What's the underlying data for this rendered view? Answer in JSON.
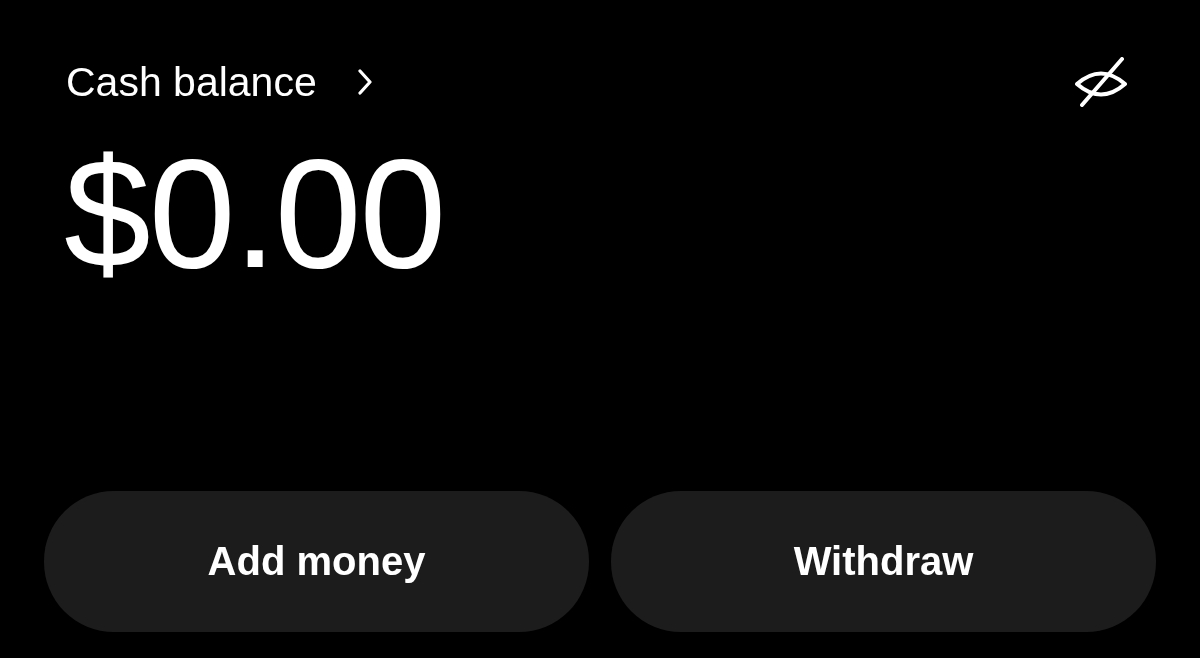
{
  "balance": {
    "label": "Cash balance",
    "amount": "$0.00"
  },
  "buttons": [
    {
      "label": "Add money"
    },
    {
      "label": "Withdraw"
    }
  ]
}
